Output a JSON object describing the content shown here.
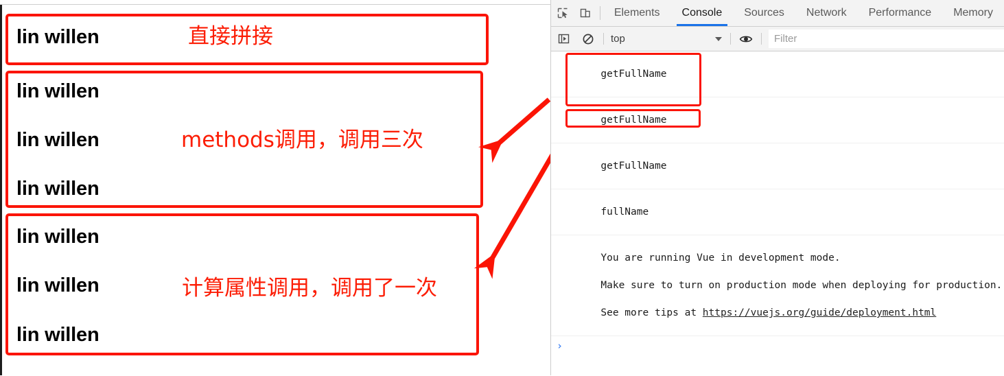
{
  "page": {
    "boxes": [
      {
        "id": "direct-concat",
        "lines": [
          "lin willen"
        ],
        "note": "直接拼接"
      },
      {
        "id": "methods-call",
        "lines": [
          "lin willen",
          "lin willen",
          "lin willen"
        ],
        "note": "methods调用，调用三次"
      },
      {
        "id": "computed-call",
        "lines": [
          "lin willen",
          "lin willen",
          "lin willen"
        ],
        "note": "计算属性调用，调用了一次"
      }
    ]
  },
  "devtools": {
    "toolbar": {
      "inspect_icon": "inspect-element-icon",
      "device_icon": "device-toolbar-icon"
    },
    "tabs": [
      {
        "label": "Elements",
        "selected": false
      },
      {
        "label": "Console",
        "selected": true
      },
      {
        "label": "Sources",
        "selected": false
      },
      {
        "label": "Network",
        "selected": false
      },
      {
        "label": "Performance",
        "selected": false
      },
      {
        "label": "Memory",
        "selected": false
      }
    ],
    "filterbar": {
      "sidebar_icon": "console-sidebar-icon",
      "clear_icon": "clear-console-icon",
      "context": "top",
      "eye_icon": "live-expression-icon",
      "filter_placeholder": "Filter"
    },
    "console": {
      "rows": [
        {
          "text": "getFullName"
        },
        {
          "text": "getFullName"
        },
        {
          "text": "getFullName"
        },
        {
          "text": "fullName"
        }
      ],
      "vue_message": {
        "line1": "You are running Vue in development mode.",
        "line2": "Make sure to turn on production mode when deploying for production.",
        "line3_prefix": "See more tips at ",
        "link": "https://vuejs.org/guide/deployment.html"
      },
      "prompt": "›"
    }
  },
  "colors": {
    "annotation_red": "#fb1405",
    "accent_blue": "#1a73e8",
    "toolbar_bg": "#f3f3f3"
  }
}
